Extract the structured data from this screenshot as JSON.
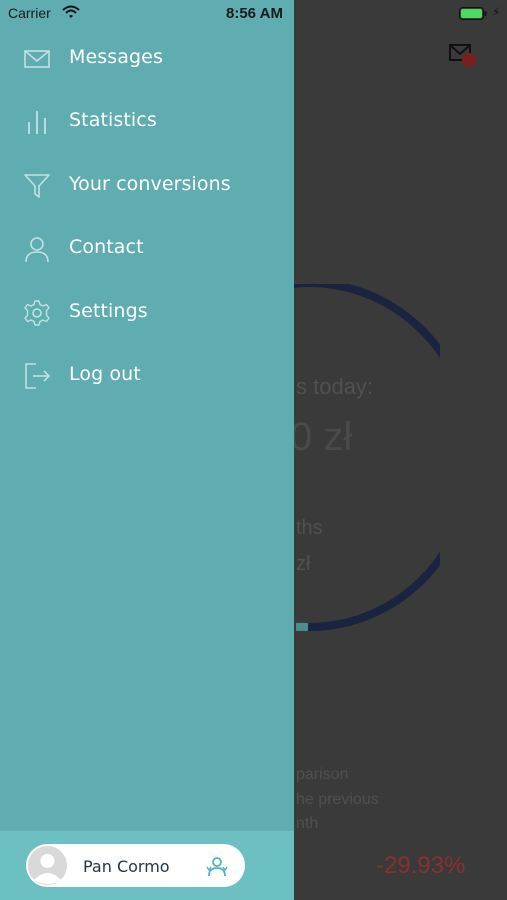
{
  "status_bar": {
    "carrier": "Carrier",
    "time": "8:56 AM",
    "battery_color": "#4cd964"
  },
  "background": {
    "today_label": "s today:",
    "amount": "0 zł",
    "months_label": "ths",
    "zl_label": "zł",
    "comparison_lines": [
      "parison",
      "he previous",
      "nth"
    ],
    "percentage": "-29.93%",
    "ring_color": "#1a2440",
    "percentage_color": "#c0392b"
  },
  "drawer": {
    "background_color": "#5fadb0",
    "items": [
      {
        "label": "Messages",
        "icon": "mail-icon"
      },
      {
        "label": "Statistics",
        "icon": "bar-chart-icon"
      },
      {
        "label": "Your conversions",
        "icon": "filter-icon"
      },
      {
        "label": "Contact",
        "icon": "user-icon"
      },
      {
        "label": "Settings",
        "icon": "gear-icon"
      },
      {
        "label": "Log out",
        "icon": "logout-icon"
      }
    ],
    "footer": {
      "user_name": "Pan Cormo",
      "switch_icon": "switch-account-icon",
      "avatar_icon": "avatar-icon"
    }
  }
}
